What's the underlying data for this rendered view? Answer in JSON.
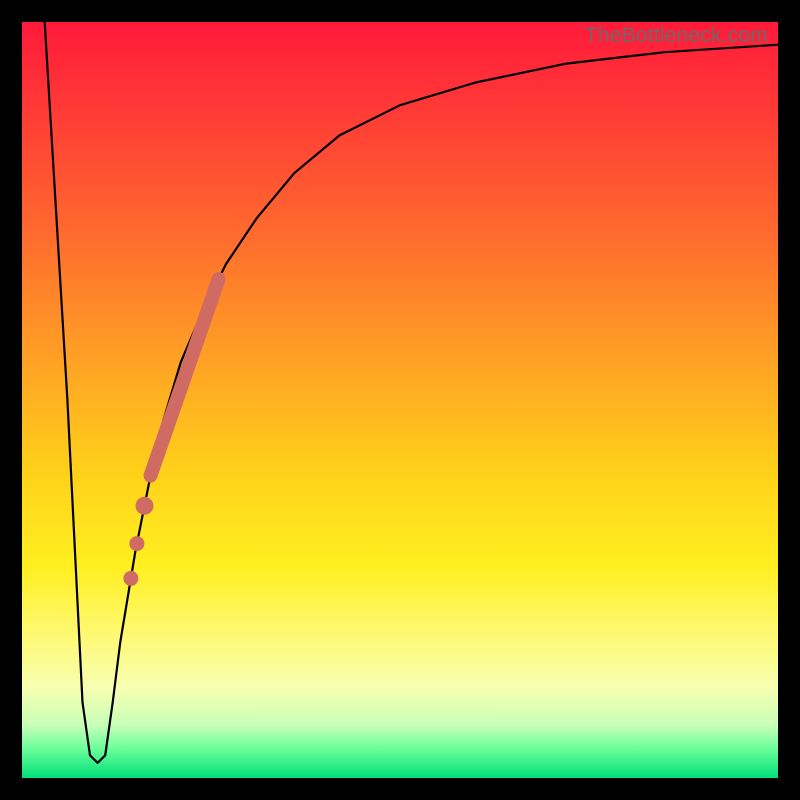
{
  "watermark": "TheBottleneck.com",
  "chart_data": {
    "type": "line",
    "title": "",
    "xlabel": "",
    "ylabel": "",
    "xlim": [
      0,
      100
    ],
    "ylim": [
      0,
      100
    ],
    "grid": false,
    "series": [
      {
        "name": "bottleneck-curve",
        "x": [
          3,
          6,
          8,
          9,
          10,
          11,
          12,
          13,
          15,
          18,
          21,
          24,
          27,
          31,
          36,
          42,
          50,
          60,
          72,
          85,
          100
        ],
        "y": [
          100,
          50,
          10,
          3,
          2,
          3,
          10,
          18,
          30,
          45,
          55,
          62,
          68,
          74,
          80,
          85,
          89,
          92,
          94.5,
          96,
          97
        ]
      }
    ],
    "highlight_segment": {
      "name": "marked-range",
      "on_series": "bottleneck-curve",
      "x_start": 17,
      "x_end": 26,
      "color": "#cf6b63"
    },
    "highlight_points": {
      "name": "marked-points",
      "on_series": "bottleneck-curve",
      "x": [
        16.2,
        15.2,
        14.4
      ],
      "color": "#cf6b63"
    },
    "background": {
      "type": "vertical-gradient",
      "stops": [
        {
          "pos": 0.0,
          "color": "#ff1a3a"
        },
        {
          "pos": 0.5,
          "color": "#ffc020"
        },
        {
          "pos": 0.8,
          "color": "#fff86a"
        },
        {
          "pos": 1.0,
          "color": "#00e07a"
        }
      ]
    }
  }
}
